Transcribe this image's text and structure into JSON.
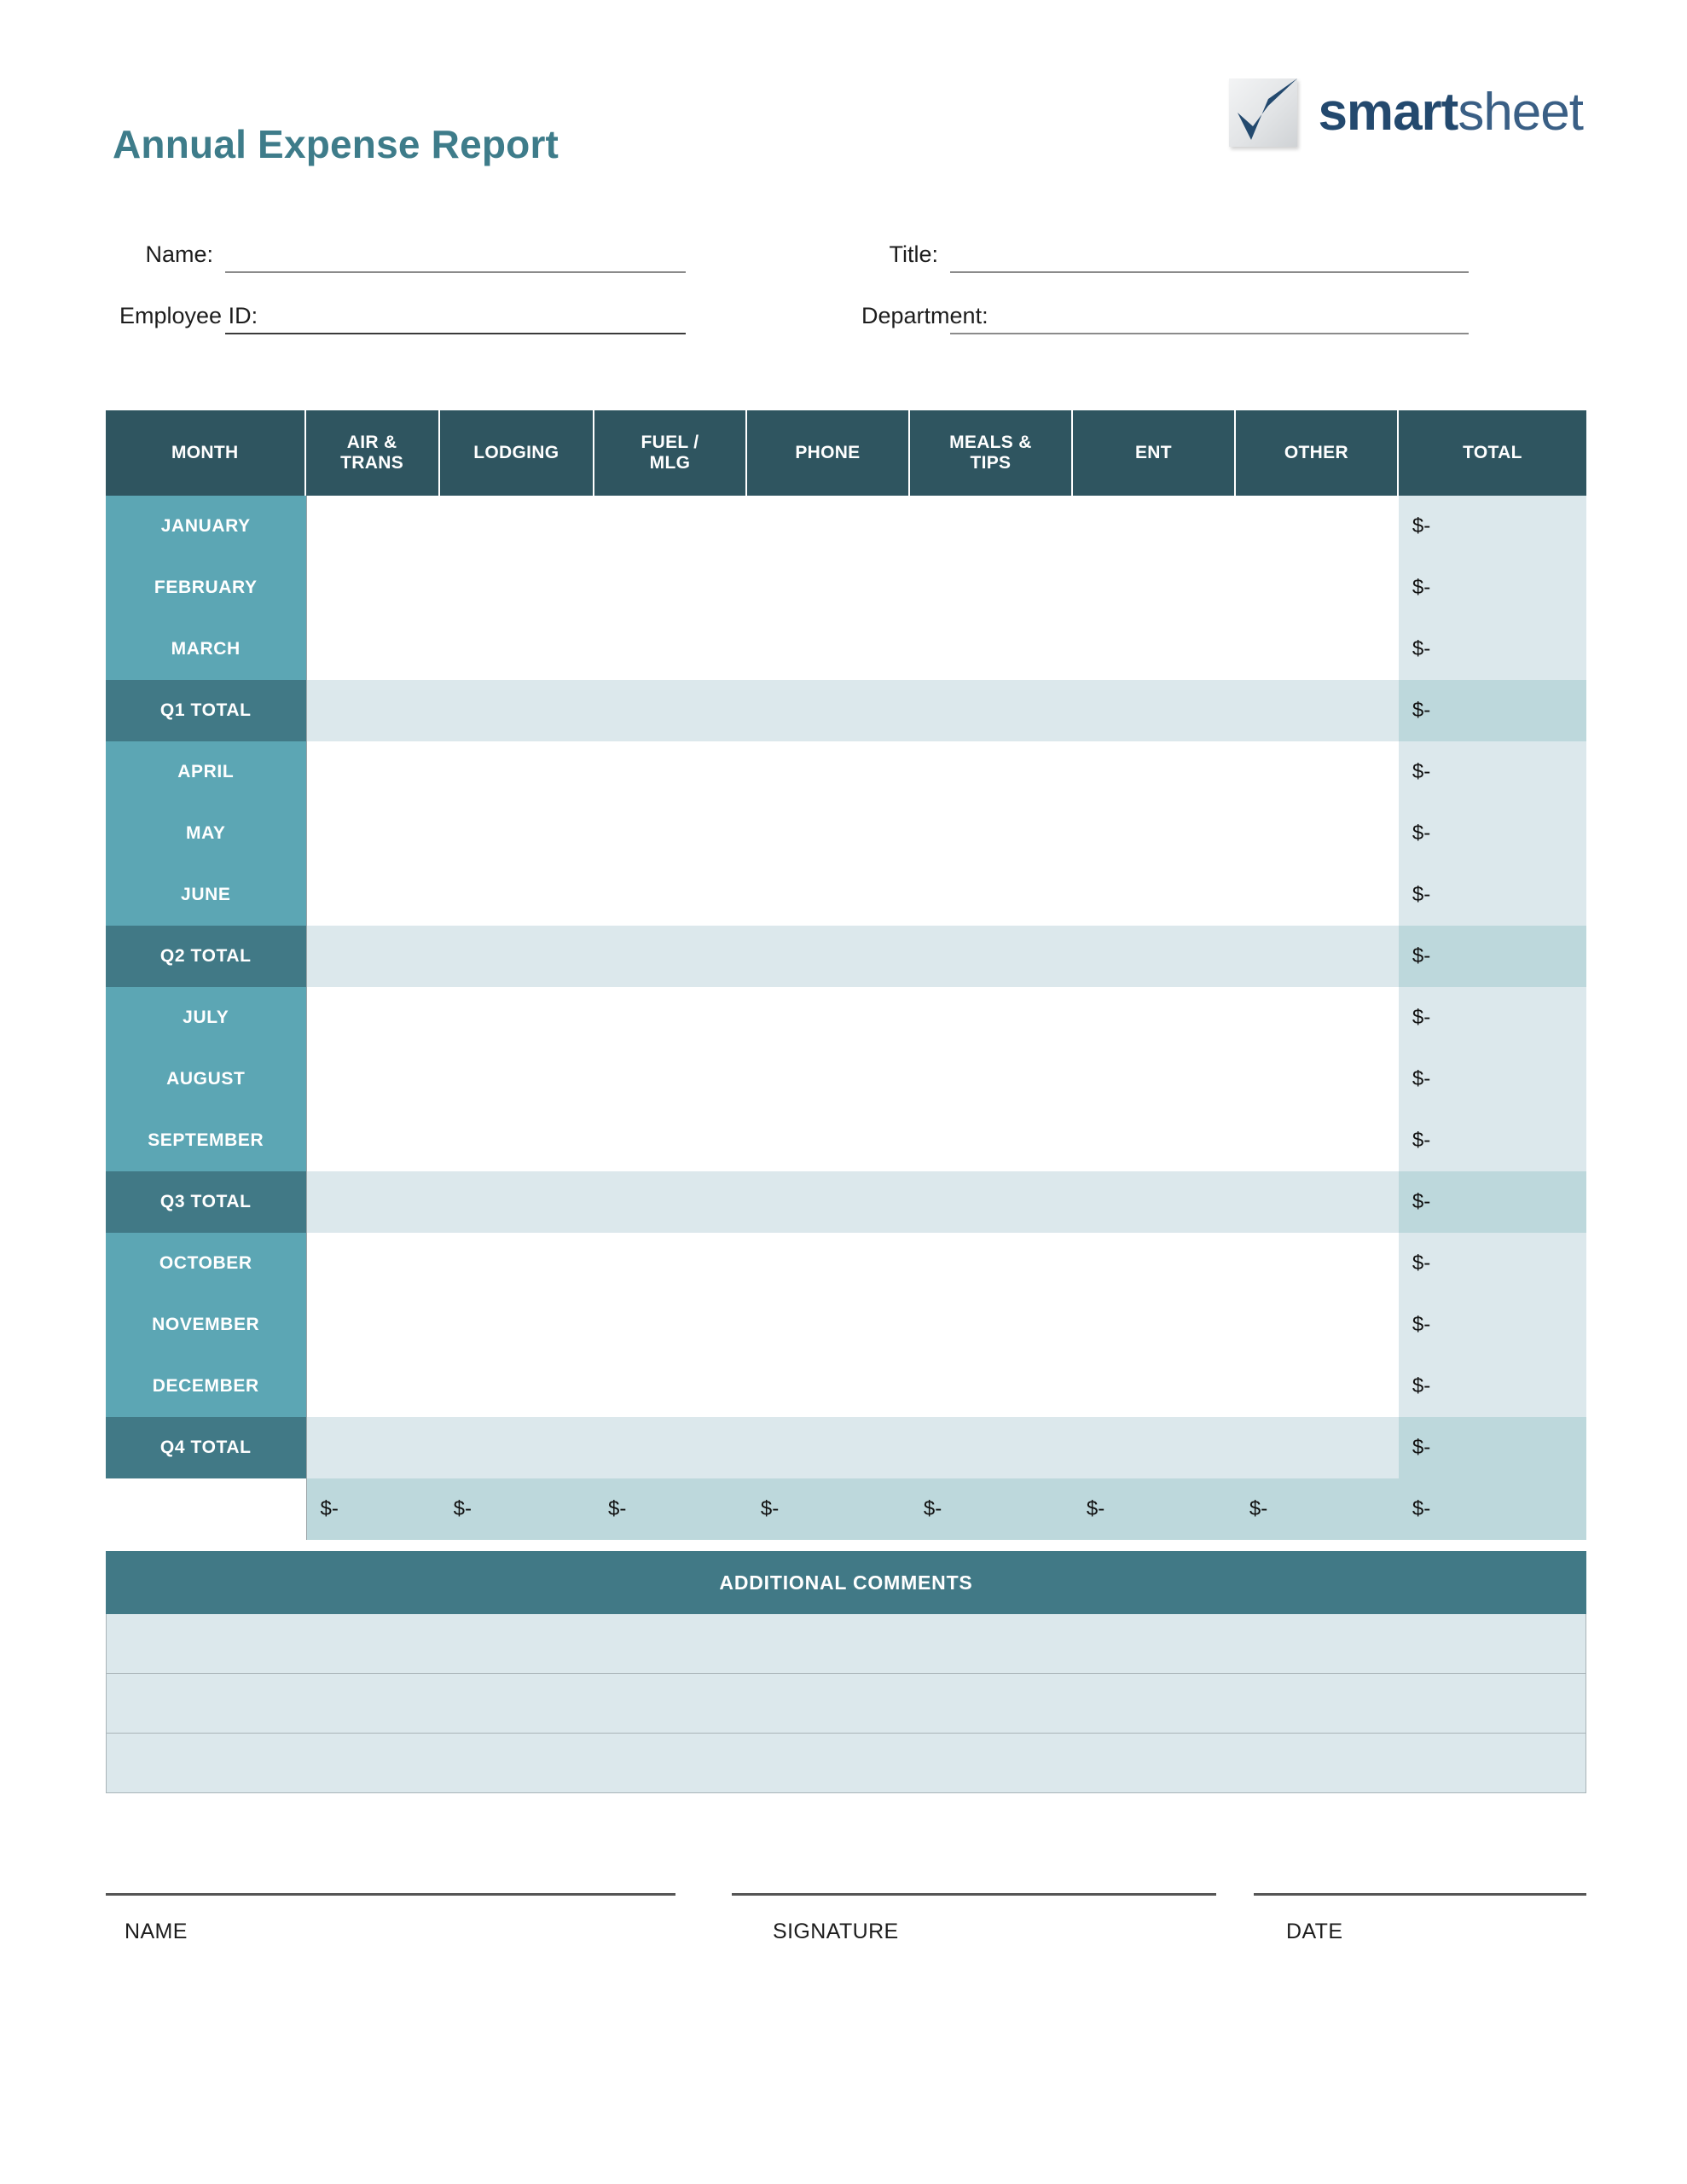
{
  "document": {
    "title": "Annual Expense Report",
    "title_color": "#3E7C8A"
  },
  "logo": {
    "brand_bold": "smart",
    "brand_light": "sheet",
    "mark": "checkmark-square"
  },
  "info_fields": {
    "name_label": "Name:",
    "name_value": "",
    "employee_id_label": "Employee ID:",
    "employee_id_value": "",
    "title_label": "Title:",
    "title_value": "",
    "department_label": "Department:",
    "department_value": ""
  },
  "expense_table": {
    "columns": [
      "MONTH",
      "AIR &\nTRANS",
      "LODGING",
      "FUEL /\nMLG",
      "PHONE",
      "MEALS &\nTIPS",
      "ENT",
      "OTHER",
      "TOTAL"
    ],
    "column_labels": {
      "month": "MONTH",
      "air_trans_line1": "AIR &",
      "air_trans_line2": "TRANS",
      "lodging": "LODGING",
      "fuel_line1": "FUEL /",
      "fuel_line2": "MLG",
      "phone": "PHONE",
      "meals_line1": "MEALS &",
      "meals_line2": "TIPS",
      "ent": "ENT",
      "other": "OTHER",
      "total": "TOTAL"
    },
    "zero_value": "$-",
    "rows": [
      {
        "label": "JANUARY",
        "type": "month",
        "values": [
          "",
          "",
          "",
          "",
          "",
          "",
          ""
        ],
        "total": "$-"
      },
      {
        "label": "FEBRUARY",
        "type": "month",
        "values": [
          "",
          "",
          "",
          "",
          "",
          "",
          ""
        ],
        "total": "$-"
      },
      {
        "label": "MARCH",
        "type": "month",
        "values": [
          "",
          "",
          "",
          "",
          "",
          "",
          ""
        ],
        "total": "$-"
      },
      {
        "label": "Q1 TOTAL",
        "type": "quarter",
        "values": [
          "",
          "",
          "",
          "",
          "",
          "",
          ""
        ],
        "total": "$-"
      },
      {
        "label": "APRIL",
        "type": "month",
        "values": [
          "",
          "",
          "",
          "",
          "",
          "",
          ""
        ],
        "total": "$-"
      },
      {
        "label": "MAY",
        "type": "month",
        "values": [
          "",
          "",
          "",
          "",
          "",
          "",
          ""
        ],
        "total": "$-"
      },
      {
        "label": "JUNE",
        "type": "month",
        "values": [
          "",
          "",
          "",
          "",
          "",
          "",
          ""
        ],
        "total": "$-"
      },
      {
        "label": "Q2 TOTAL",
        "type": "quarter",
        "values": [
          "",
          "",
          "",
          "",
          "",
          "",
          ""
        ],
        "total": "$-"
      },
      {
        "label": "JULY",
        "type": "month",
        "values": [
          "",
          "",
          "",
          "",
          "",
          "",
          ""
        ],
        "total": "$-"
      },
      {
        "label": "AUGUST",
        "type": "month",
        "values": [
          "",
          "",
          "",
          "",
          "",
          "",
          ""
        ],
        "total": "$-"
      },
      {
        "label": "SEPTEMBER",
        "type": "month",
        "values": [
          "",
          "",
          "",
          "",
          "",
          "",
          ""
        ],
        "total": "$-"
      },
      {
        "label": "Q3 TOTAL",
        "type": "quarter",
        "values": [
          "",
          "",
          "",
          "",
          "",
          "",
          ""
        ],
        "total": "$-"
      },
      {
        "label": "OCTOBER",
        "type": "month",
        "values": [
          "",
          "",
          "",
          "",
          "",
          "",
          ""
        ],
        "total": "$-"
      },
      {
        "label": "NOVEMBER",
        "type": "month",
        "values": [
          "",
          "",
          "",
          "",
          "",
          "",
          ""
        ],
        "total": "$-"
      },
      {
        "label": "DECEMBER",
        "type": "month",
        "values": [
          "",
          "",
          "",
          "",
          "",
          "",
          ""
        ],
        "total": "$-"
      },
      {
        "label": "Q4 TOTAL",
        "type": "quarter",
        "values": [
          "",
          "",
          "",
          "",
          "",
          "",
          ""
        ],
        "total": "$-"
      }
    ],
    "grand_total_row": {
      "label": "",
      "values": [
        "$-",
        "$-",
        "$-",
        "$-",
        "$-",
        "$-",
        "$-"
      ],
      "total": "$-"
    }
  },
  "comments": {
    "heading": "ADDITIONAL COMMENTS",
    "lines": [
      "",
      "",
      ""
    ]
  },
  "signatures": {
    "name_caption": "NAME",
    "signature_caption": "SIGNATURE",
    "date_caption": "DATE"
  },
  "colors": {
    "header_dark": "#2F5560",
    "month_teal": "#5CA6B4",
    "quarter_teal": "#417986",
    "total_light": "#DCE8EC",
    "total_mid": "#BDD8DC",
    "title_teal": "#3E7C8A",
    "logo_navy": "#23496E"
  }
}
